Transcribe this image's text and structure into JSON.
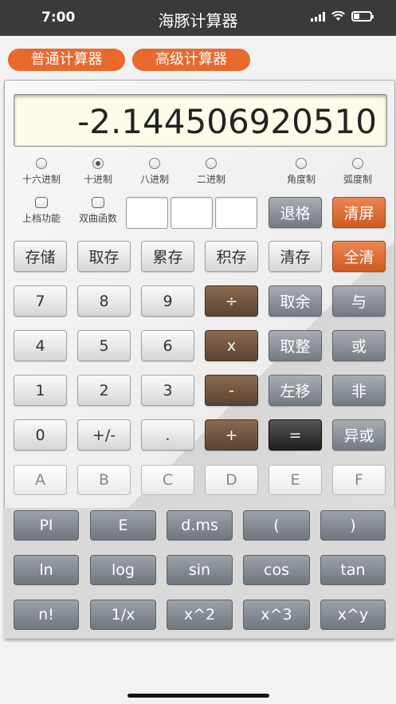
{
  "status_bar": {
    "time": "7:00",
    "title": "海豚计算器"
  },
  "tabs": [
    "普通计算器",
    "高级计算器"
  ],
  "display": {
    "value": "-2.144506920510"
  },
  "base_options": [
    {
      "label": "十六进制",
      "checked": false
    },
    {
      "label": "十进制",
      "checked": true
    },
    {
      "label": "八进制",
      "checked": false
    },
    {
      "label": "二进制",
      "checked": false
    }
  ],
  "angle_options": [
    {
      "label": "角度制",
      "checked": false
    },
    {
      "label": "弧度制",
      "checked": false
    }
  ],
  "checkboxes": [
    {
      "label": "上档功能",
      "checked": false
    },
    {
      "label": "双曲函数",
      "checked": false
    }
  ],
  "buttons": {
    "backspace": "退格",
    "clear_screen": "清屏",
    "store": "存储",
    "recall": "取存",
    "add_store": "累存",
    "mul_store": "积存",
    "clear_store": "清存",
    "all_clear": "全清",
    "seven": "7",
    "eight": "8",
    "nine": "9",
    "divide": "÷",
    "mod": "取余",
    "and": "与",
    "four": "4",
    "five": "5",
    "six": "6",
    "multiply": "x",
    "int": "取整",
    "or": "或",
    "one": "1",
    "two": "2",
    "three": "3",
    "minus": "-",
    "lshift": "左移",
    "not": "非",
    "zero": "0",
    "negate": "+/-",
    "dot": ".",
    "plus": "+",
    "equals": "=",
    "xor": "异或",
    "hex_a": "A",
    "hex_b": "B",
    "hex_c": "C",
    "hex_d": "D",
    "hex_e": "E",
    "hex_f": "F",
    "pi": "PI",
    "e": "E",
    "dms": "d.ms",
    "lparen": "(",
    "rparen": ")",
    "ln": "ln",
    "log": "log",
    "sin": "sin",
    "cos": "cos",
    "tan": "tan",
    "fact": "n!",
    "recip": "1/x",
    "square": "x^2",
    "cube": "x^3",
    "pow": "x^y"
  }
}
